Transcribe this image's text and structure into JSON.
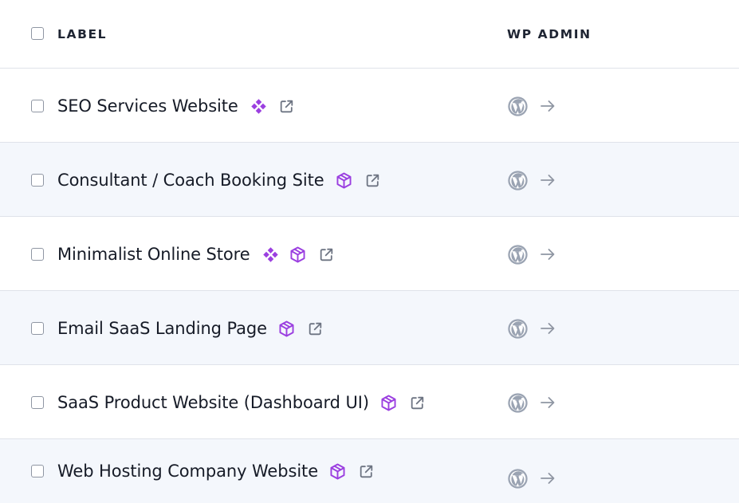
{
  "header": {
    "label_column": "LABEL",
    "wp_admin_column": "WP ADMIN"
  },
  "colors": {
    "badge_purple": "#9b3fe0",
    "icon_gray": "#6d7482",
    "wp_gray": "#9aa3b2"
  },
  "rows": [
    {
      "label": "SEO Services Website",
      "badges": [
        "diamond-icon"
      ],
      "external_link_icon": "external-link-icon",
      "wp_icon": "wordpress-icon",
      "go_icon": "arrow-right-icon"
    },
    {
      "label": "Consultant / Coach Booking Site",
      "badges": [
        "cube-icon"
      ],
      "external_link_icon": "external-link-icon",
      "wp_icon": "wordpress-icon",
      "go_icon": "arrow-right-icon"
    },
    {
      "label": "Minimalist Online Store",
      "badges": [
        "diamond-icon",
        "cube-icon"
      ],
      "external_link_icon": "external-link-icon",
      "wp_icon": "wordpress-icon",
      "go_icon": "arrow-right-icon"
    },
    {
      "label": "Email SaaS Landing Page",
      "badges": [
        "cube-icon"
      ],
      "external_link_icon": "external-link-icon",
      "wp_icon": "wordpress-icon",
      "go_icon": "arrow-right-icon"
    },
    {
      "label": "SaaS Product Website (Dashboard UI)",
      "badges": [
        "cube-icon"
      ],
      "external_link_icon": "external-link-icon",
      "wp_icon": "wordpress-icon",
      "go_icon": "arrow-right-icon"
    },
    {
      "label": "Web Hosting Company Website",
      "badges": [
        "cube-icon"
      ],
      "external_link_icon": "external-link-icon",
      "wp_icon": "wordpress-icon",
      "go_icon": "arrow-right-icon"
    }
  ]
}
